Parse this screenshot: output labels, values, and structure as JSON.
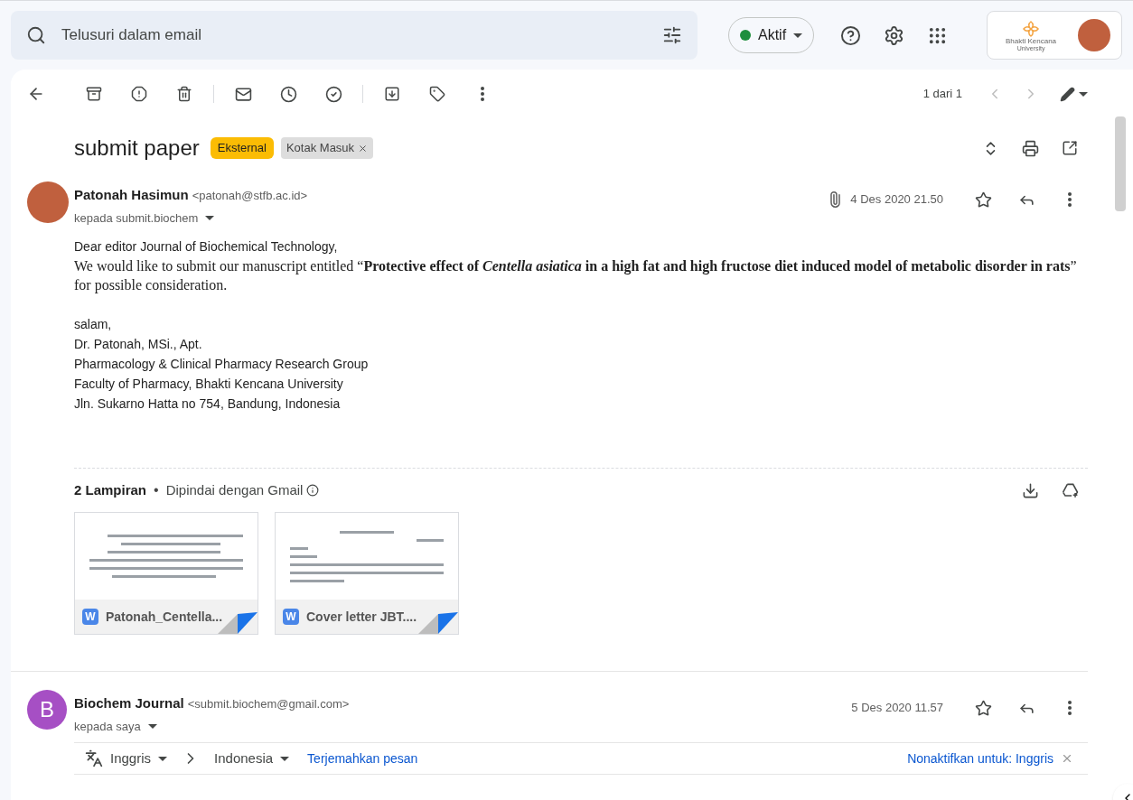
{
  "search": {
    "placeholder": "Telusuri dalam email"
  },
  "status": {
    "label": "Aktif",
    "on": true
  },
  "account": {
    "org_name": "Bhakti Kencana",
    "org_sub": "University"
  },
  "pagination": "1 dari 1",
  "subject": "submit paper",
  "labels": [
    {
      "text": "Eksternal",
      "kind": "category"
    },
    {
      "text": "Kotak Masuk",
      "kind": "folder"
    }
  ],
  "messages": [
    {
      "sender": "Patonah Hasimun",
      "email": "<patonah@stfb.ac.id>",
      "recipient": "kepada submit.biochem",
      "date": "4 Des 2020 21.50",
      "has_attachment": true,
      "avatar": {
        "kind": "photo"
      },
      "starred": false,
      "body": {
        "greeting": "Dear editor Journal of Biochemical Technology,",
        "paragraph": {
          "before": "We would like to submit our manuscript entitled “",
          "title": "Protective effect of *Centella asiatica* in a high fat and high fructose diet induced model of metabolic disorder in rats",
          "after": "” for possible consideration."
        },
        "signature": [
          "salam,",
          "Dr. Patonah, MSi., Apt.",
          "Pharmacology & Clinical Pharmacy Research Group",
          "Faculty of Pharmacy, Bhakti Kencana University",
          "Jln. Sukarno Hatta no 754, Bandung, Indonesia"
        ]
      },
      "attachments": {
        "count": "2 Lampiran",
        "separator": "•",
        "scan_note": "Dipindai dengan Gmail",
        "files": [
          {
            "name": "Patonah_Centella...",
            "kind": "word",
            "type_letter": "W"
          },
          {
            "name": "Cover letter JBT....",
            "kind": "word",
            "type_letter": "W"
          }
        ]
      }
    },
    {
      "sender": "Biochem Journal",
      "email": "<submit.biochem@gmail.com>",
      "recipient": "kepada saya",
      "date": "5 Des 2020 11.57",
      "has_attachment": false,
      "avatar": {
        "kind": "letter",
        "letter": "B",
        "color": "#a64fc4"
      },
      "starred": false,
      "translate": {
        "from": "Inggris",
        "to": "Indonesia",
        "action": "Terjemahkan pesan",
        "disable": "Nonaktifkan untuk: Inggris"
      }
    }
  ]
}
